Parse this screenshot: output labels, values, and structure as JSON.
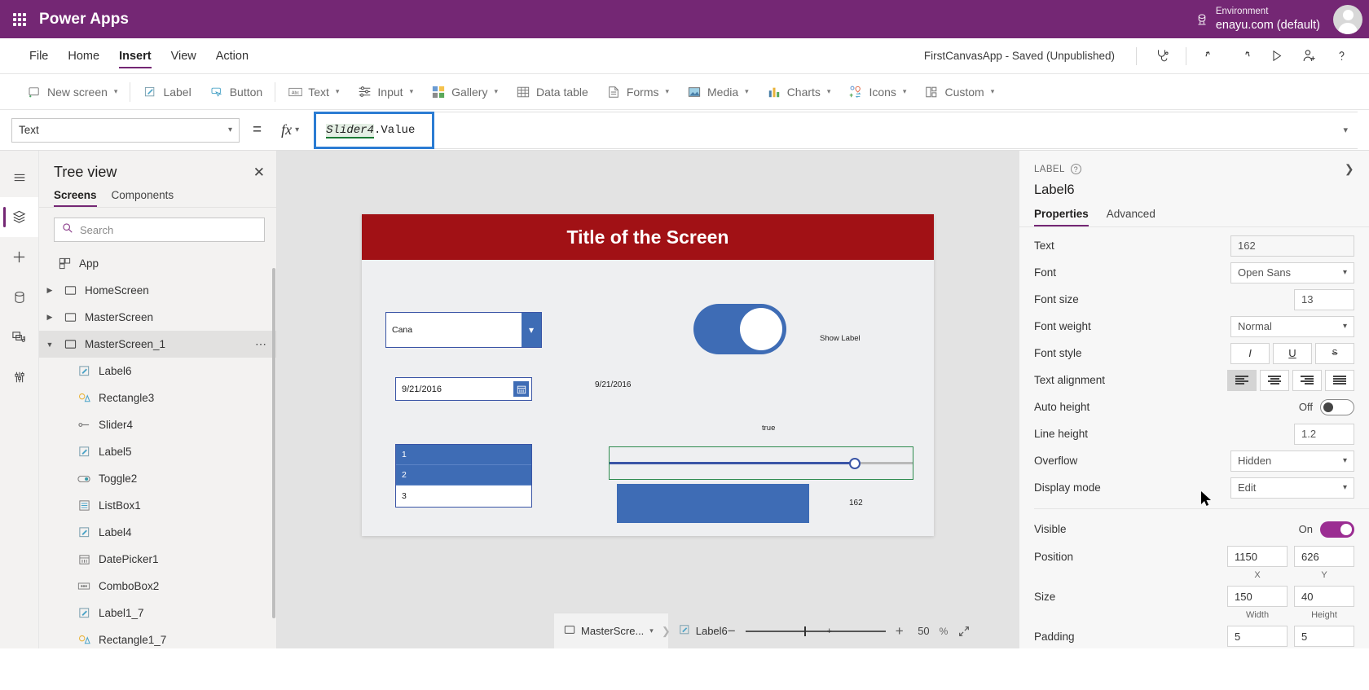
{
  "topbar": {
    "brand": "Power Apps",
    "environment_label": "Environment",
    "environment_name": "enayu.com (default)",
    "waffle_icon": "app-launcher-icon",
    "env_icon": "environment-icon",
    "avatar_icon": "user-avatar"
  },
  "menubar": {
    "items": [
      {
        "label": "File",
        "active": false
      },
      {
        "label": "Home",
        "active": false
      },
      {
        "label": "Insert",
        "active": true
      },
      {
        "label": "View",
        "active": false
      },
      {
        "label": "Action",
        "active": false
      }
    ],
    "app_status": "FirstCanvasApp - Saved (Unpublished)",
    "icons": [
      "app-checker-icon",
      "undo-icon",
      "redo-icon",
      "play-preview-icon",
      "share-icon",
      "help-icon"
    ]
  },
  "ribbon": {
    "items": [
      {
        "label": "New screen",
        "icon": "new-screen-icon",
        "caret": true
      },
      {
        "label": "Label",
        "icon": "label-icon",
        "caret": false
      },
      {
        "label": "Button",
        "icon": "button-icon",
        "caret": false
      },
      {
        "label": "Text",
        "icon": "text-icon",
        "caret": true
      },
      {
        "label": "Input",
        "icon": "input-icon",
        "caret": true
      },
      {
        "label": "Gallery",
        "icon": "gallery-icon",
        "caret": true
      },
      {
        "label": "Data table",
        "icon": "data-table-icon",
        "caret": false
      },
      {
        "label": "Forms",
        "icon": "forms-icon",
        "caret": true
      },
      {
        "label": "Media",
        "icon": "media-icon",
        "caret": true
      },
      {
        "label": "Charts",
        "icon": "charts-icon",
        "caret": true
      },
      {
        "label": "Icons",
        "icon": "icons-icon",
        "caret": true
      },
      {
        "label": "Custom",
        "icon": "custom-icon",
        "caret": true
      }
    ]
  },
  "formulabar": {
    "property": "Text",
    "equals": "=",
    "fx": "fx",
    "formula_token": "Slider4",
    "formula_rest": ".Value"
  },
  "rail": {
    "items": [
      {
        "icon": "hamburger-menu-icon",
        "active": false
      },
      {
        "icon": "tree-view-layers-icon",
        "active": true
      },
      {
        "icon": "insert-plus-icon",
        "active": false
      },
      {
        "icon": "data-sources-icon",
        "active": false
      },
      {
        "icon": "media-library-icon",
        "active": false
      },
      {
        "icon": "advanced-tools-icon",
        "active": false
      }
    ]
  },
  "treeview": {
    "title": "Tree view",
    "close_icon": "close-icon",
    "tabs": [
      {
        "label": "Screens",
        "active": true
      },
      {
        "label": "Components",
        "active": false
      }
    ],
    "search_placeholder": "Search",
    "search_value": "",
    "search_icon": "search-icon",
    "nodes": [
      {
        "label": "App",
        "icon": "app-node-icon",
        "chevron": "",
        "indent": 0,
        "selected": false,
        "dots": false
      },
      {
        "label": "HomeScreen",
        "icon": "screen-icon",
        "chevron": "collapsed",
        "indent": 0,
        "selected": false,
        "dots": false
      },
      {
        "label": "MasterScreen",
        "icon": "screen-icon",
        "chevron": "collapsed",
        "indent": 0,
        "selected": false,
        "dots": false
      },
      {
        "label": "MasterScreen_1",
        "icon": "screen-icon",
        "chevron": "expanded",
        "indent": 0,
        "selected": true,
        "dots": true
      },
      {
        "label": "Label6",
        "icon": "label-node-icon",
        "chevron": "",
        "indent": 1,
        "selected": false,
        "dots": false
      },
      {
        "label": "Rectangle3",
        "icon": "shape-node-icon",
        "chevron": "",
        "indent": 1,
        "selected": false,
        "dots": false
      },
      {
        "label": "Slider4",
        "icon": "slider-node-icon",
        "chevron": "",
        "indent": 1,
        "selected": false,
        "dots": false
      },
      {
        "label": "Label5",
        "icon": "label-node-icon",
        "chevron": "",
        "indent": 1,
        "selected": false,
        "dots": false
      },
      {
        "label": "Toggle2",
        "icon": "toggle-node-icon",
        "chevron": "",
        "indent": 1,
        "selected": false,
        "dots": false
      },
      {
        "label": "ListBox1",
        "icon": "listbox-node-icon",
        "chevron": "",
        "indent": 1,
        "selected": false,
        "dots": false
      },
      {
        "label": "Label4",
        "icon": "label-node-icon",
        "chevron": "",
        "indent": 1,
        "selected": false,
        "dots": false
      },
      {
        "label": "DatePicker1",
        "icon": "datepicker-node-icon",
        "chevron": "",
        "indent": 1,
        "selected": false,
        "dots": false
      },
      {
        "label": "ComboBox2",
        "icon": "combobox-node-icon",
        "chevron": "",
        "indent": 1,
        "selected": false,
        "dots": false
      },
      {
        "label": "Label1_7",
        "icon": "label-node-icon",
        "chevron": "",
        "indent": 1,
        "selected": false,
        "dots": false
      },
      {
        "label": "Rectangle1_7",
        "icon": "shape-node-icon",
        "chevron": "",
        "indent": 1,
        "selected": false,
        "dots": false
      }
    ]
  },
  "canvas": {
    "screen_title": "Title of the Screen",
    "combobox_value": "Cana",
    "toggle_label": "Show Label",
    "datepicker_value": "9/21/2016",
    "date_label": "9/21/2016",
    "bool_label": "true",
    "listbox_items": [
      {
        "label": "1",
        "selected": true
      },
      {
        "label": "2",
        "selected": true
      },
      {
        "label": "3",
        "selected": false
      }
    ],
    "slider_value_label": "162",
    "colors": {
      "title_bar": "#a11115",
      "accent_blue": "#3e6cb5",
      "selection_green": "#2e8b4f",
      "screen_bg": "#eeeff1"
    }
  },
  "statusbar": {
    "breadcrumb_screen": "MasterScre...",
    "breadcrumb_control": "Label6",
    "screen_icon": "screen-icon",
    "control_icon": "label-node-icon",
    "zoom_out": "−",
    "zoom_in": "+",
    "zoom_percent": "50",
    "zoom_unit": "%",
    "expand_icon": "fit-to-screen-icon"
  },
  "properties": {
    "kicker": "LABEL",
    "help_icon": "help-circle-icon",
    "expand_icon": "chevron-right-icon",
    "control_name": "Label6",
    "tabs": [
      {
        "label": "Properties",
        "active": true
      },
      {
        "label": "Advanced",
        "active": false
      }
    ],
    "fields": {
      "text_label": "Text",
      "text_value": "162",
      "font_label": "Font",
      "font_value": "Open Sans",
      "font_size_label": "Font size",
      "font_size_value": "13",
      "font_weight_label": "Font weight",
      "font_weight_value": "Normal",
      "font_style_label": "Font style",
      "font_style_italic": "I",
      "font_style_underline": "U",
      "font_style_strike": "S",
      "text_align_label": "Text alignment",
      "auto_height_label": "Auto height",
      "auto_height_state": "Off",
      "line_height_label": "Line height",
      "line_height_value": "1.2",
      "overflow_label": "Overflow",
      "overflow_value": "Hidden",
      "display_mode_label": "Display mode",
      "display_mode_value": "Edit",
      "visible_label": "Visible",
      "visible_state": "On",
      "position_label": "Position",
      "position_x": "1150",
      "position_y": "626",
      "position_x_sub": "X",
      "position_y_sub": "Y",
      "size_label": "Size",
      "size_width": "150",
      "size_height": "40",
      "size_width_sub": "Width",
      "size_height_sub": "Height",
      "padding_label": "Padding",
      "padding_top": "5",
      "padding_bottom": "5"
    }
  }
}
